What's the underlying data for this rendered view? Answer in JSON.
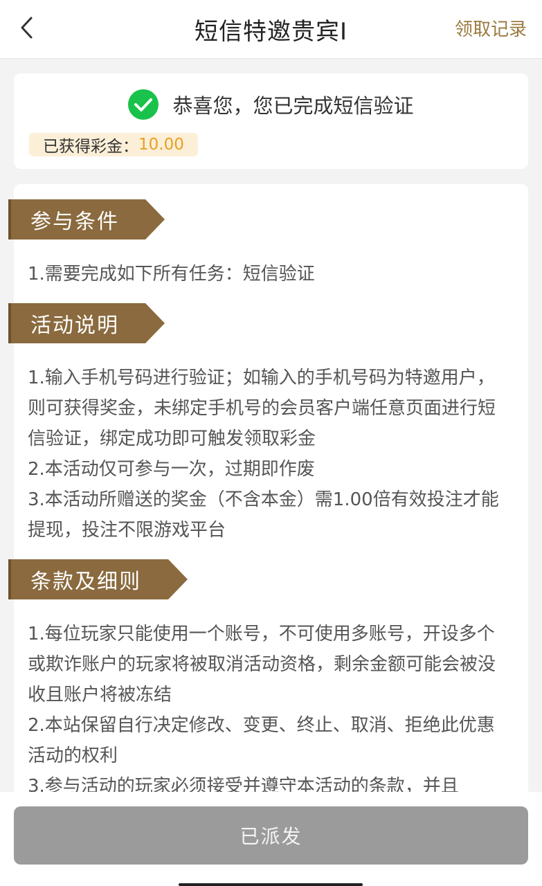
{
  "header": {
    "title": "短信特邀贵宾I",
    "records_label": "领取记录",
    "back_icon": "chevron-left-icon"
  },
  "status": {
    "message": "恭喜您，您已完成短信验证",
    "bonus_label": "已获得彩金：",
    "bonus_amount": "10.00",
    "check_icon": "check-circle-icon",
    "check_color": "#19c24a"
  },
  "sections": {
    "conditions": {
      "title": "参与条件",
      "lines": [
        "1.需要完成如下所有任务：短信验证"
      ]
    },
    "description": {
      "title": "活动说明",
      "lines": [
        "1.输入手机号码进行验证；如输入的手机号码为特邀用户，则可获得奖金，未绑定手机号的会员客户端任意页面进行短信验证，绑定成功即可触发领取彩金",
        "2.本活动仅可参与一次，过期即作废",
        "3.本活动所赠送的奖金（不含本金）需1.00倍有效投注才能提现，投注不限游戏平台"
      ]
    },
    "terms": {
      "title": "条款及细则",
      "lines": [
        "1.每位玩家只能使用一个账号，不可使用多账号，开设多个或欺诈账户的玩家将被取消活动资格，剩余金额可能会被没收且账户将被冻结",
        "2.本站保留自行决定修改、变更、终止、取消、拒绝此优惠活动的权利",
        "3.参与活动的玩家必须接受并遵守本活动的条款，并且"
      ]
    }
  },
  "footer": {
    "button_label": "已派发"
  },
  "colors": {
    "accent_gold": "#9b7a3f",
    "tag_brown": "#8a6a3e",
    "amount_orange": "#e8a020",
    "disabled_gray": "#9b9b9b"
  }
}
